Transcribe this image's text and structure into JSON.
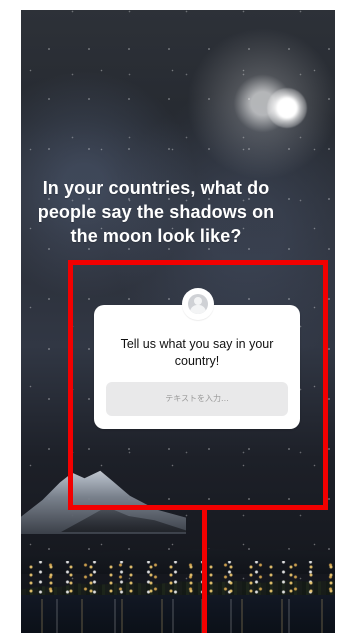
{
  "story": {
    "question": "In your countries, what do people say the shadows on the moon look like?"
  },
  "question_sticker": {
    "prompt": "Tell us what you say in your country!",
    "input_placeholder": "テキストを入力..."
  },
  "annotation": {
    "color": "#f20000"
  }
}
